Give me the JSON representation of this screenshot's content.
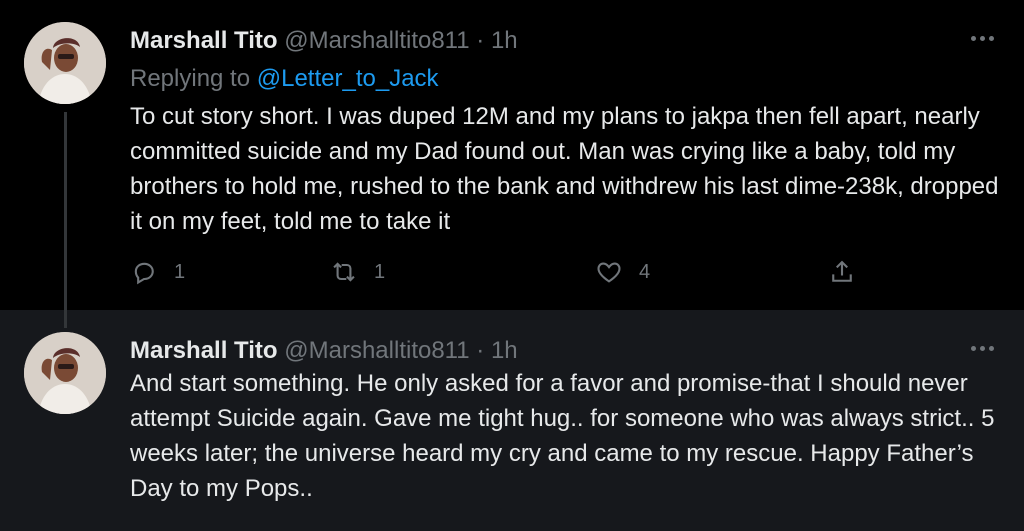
{
  "tweets": [
    {
      "name": "Marshall Tito",
      "handle": "@Marshalltito811",
      "separator": "·",
      "time": "1h",
      "replying_prefix": "Replying to",
      "replying_to": "@Letter_to_Jack",
      "text": "To cut story short. I was duped 12M and my plans to jakpa then fell apart, nearly committed suicide and my Dad found out. Man was crying like a baby, told my brothers to hold me, rushed to the bank and withdrew his last dime-238k, dropped it on my feet, told me to take it",
      "replies": "1",
      "retweets": "1",
      "likes": "4"
    },
    {
      "name": "Marshall Tito",
      "handle": "@Marshalltito811",
      "separator": "·",
      "time": "1h",
      "text": "And start something. He only asked for a favor and promise-that I should never attempt Suicide again. Gave me tight hug.. for someone who was always strict.. 5 weeks later; the universe heard my cry and came to my rescue. Happy Father’s Day to my Pops.."
    }
  ],
  "icons": {
    "reply": "reply-icon",
    "retweet": "retweet-icon",
    "like": "heart-icon",
    "share": "share-icon",
    "more": "more-icon"
  },
  "colors": {
    "background": "#000000",
    "highlight_background": "#16181c",
    "link": "#1d9bf0",
    "secondary_text": "#71767b",
    "primary_text": "#e7e9ea"
  }
}
